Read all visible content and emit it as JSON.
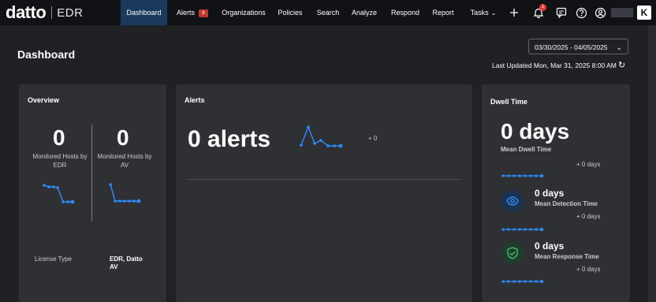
{
  "brand": {
    "name": "datto",
    "product": "EDR"
  },
  "nav": {
    "items": [
      {
        "label": "Dashboard"
      },
      {
        "label": "Alerts",
        "badge": "8"
      },
      {
        "label": "Organizations"
      },
      {
        "label": "Policies"
      },
      {
        "label": "Search"
      },
      {
        "label": "Analyze"
      },
      {
        "label": "Respond"
      },
      {
        "label": "Report"
      },
      {
        "label": "Tasks"
      }
    ],
    "notification_count": "1",
    "icons": [
      "plus-icon",
      "bell-icon",
      "message-icon",
      "help-icon",
      "user-icon",
      "kaseya-logo"
    ]
  },
  "page": {
    "title": "Dashboard",
    "date_range": "03/30/2025 - 04/05/2025",
    "last_updated": "Last Updated Mon, Mar 31, 2025 8:00 AM"
  },
  "overview": {
    "title": "Overview",
    "edr_count": "0",
    "edr_label": "Monitored Hosts by EDR",
    "av_count": "0",
    "av_label": "Monitored Hosts by AV",
    "license_label": "License Type",
    "license_value": "EDR, Datto AV"
  },
  "alerts": {
    "title": "Alerts",
    "summary": "0 alerts",
    "delta": "+ 0"
  },
  "dwell": {
    "title": "Dwell Time",
    "mean_value": "0 days",
    "mean_label": "Mean Dwell Time",
    "mean_delta": "+ 0 days",
    "detection_value": "0 days",
    "detection_label": "Mean Detection Time",
    "detection_delta": "+ 0 days",
    "response_value": "0 days",
    "response_label": "Mean Response Time",
    "response_delta": "+ 0 days"
  },
  "colors": {
    "accent_blue": "#2d8cff",
    "nav_active": "#1a3a5c",
    "badge_red": "#c0392b",
    "detection_circle": "#1d3352",
    "response_circle": "#1f3d2c",
    "response_icon": "#3ec06a"
  }
}
